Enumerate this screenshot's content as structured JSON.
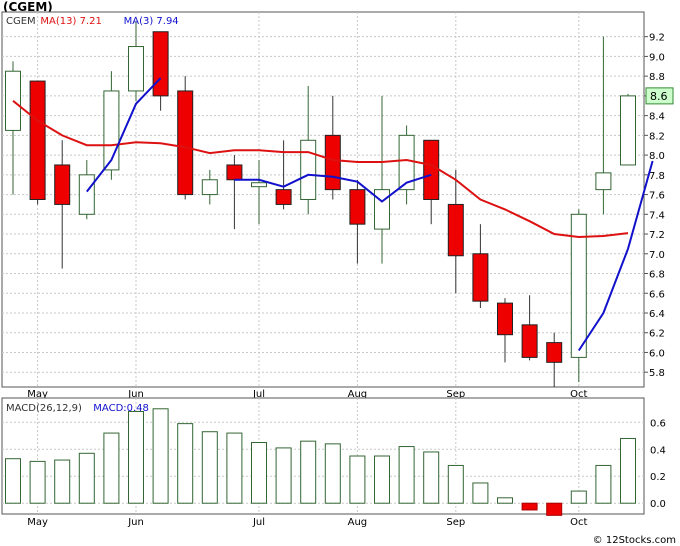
{
  "title": "(CGEM)",
  "credit": "© 12Stocks.com",
  "chart_data": [
    {
      "type": "candlestick",
      "legend": [
        {
          "label": "CGEM",
          "color": "#333333"
        },
        {
          "label": "MA(13)",
          "value": "7.21",
          "color": "#dd1111"
        },
        {
          "label": "MA(3)",
          "value": "7.94",
          "color": "#1111cc"
        }
      ],
      "last_price_label": "8.6",
      "ylim": [
        5.65,
        9.45
      ],
      "y_ticks": [
        5.8,
        6.0,
        6.2,
        6.4,
        6.6,
        6.8,
        7.0,
        7.2,
        7.4,
        7.6,
        7.8,
        8.0,
        8.2,
        8.4,
        8.6,
        8.8,
        9.0,
        9.2
      ],
      "x_ticks": [
        {
          "label": "May",
          "index": 1
        },
        {
          "label": "Jun",
          "index": 5
        },
        {
          "label": "Jul",
          "index": 10
        },
        {
          "label": "Aug",
          "index": 14
        },
        {
          "label": "Sep",
          "index": 18
        },
        {
          "label": "Oct",
          "index": 23
        }
      ],
      "candles": [
        {
          "open": 8.25,
          "high": 8.95,
          "low": 7.6,
          "close": 8.85
        },
        {
          "open": 8.75,
          "high": 8.75,
          "low": 7.5,
          "close": 7.55
        },
        {
          "open": 7.9,
          "high": 8.15,
          "low": 6.85,
          "close": 7.5
        },
        {
          "open": 7.4,
          "high": 7.95,
          "low": 7.35,
          "close": 7.8
        },
        {
          "open": 7.85,
          "high": 8.85,
          "low": 7.75,
          "close": 8.65
        },
        {
          "open": 8.65,
          "high": 9.35,
          "low": 8.55,
          "close": 9.1
        },
        {
          "open": 9.25,
          "high": 9.25,
          "low": 8.45,
          "close": 8.6
        },
        {
          "open": 8.65,
          "high": 8.8,
          "low": 7.55,
          "close": 7.6
        },
        {
          "open": 7.6,
          "high": 7.85,
          "low": 7.5,
          "close": 7.75
        },
        {
          "open": 7.9,
          "high": 8.0,
          "low": 7.25,
          "close": 7.75
        },
        {
          "open": 7.68,
          "high": 7.95,
          "low": 7.3,
          "close": 7.72
        },
        {
          "open": 7.65,
          "high": 8.15,
          "low": 7.45,
          "close": 7.5
        },
        {
          "open": 7.55,
          "high": 8.7,
          "low": 7.4,
          "close": 8.15
        },
        {
          "open": 8.2,
          "high": 8.6,
          "low": 7.55,
          "close": 7.65
        },
        {
          "open": 7.65,
          "high": 7.75,
          "low": 6.9,
          "close": 7.3
        },
        {
          "open": 7.25,
          "high": 8.6,
          "low": 6.9,
          "close": 7.65
        },
        {
          "open": 7.65,
          "high": 8.3,
          "low": 7.5,
          "close": 8.2
        },
        {
          "open": 8.15,
          "high": 8.15,
          "low": 7.3,
          "close": 7.55
        },
        {
          "open": 7.5,
          "high": 7.85,
          "low": 6.6,
          "close": 6.98
        },
        {
          "open": 7.0,
          "high": 7.3,
          "low": 6.45,
          "close": 6.52
        },
        {
          "open": 6.5,
          "high": 6.55,
          "low": 5.9,
          "close": 6.18
        },
        {
          "open": 6.28,
          "high": 6.58,
          "low": 5.92,
          "close": 5.95
        },
        {
          "open": 6.1,
          "high": 6.2,
          "low": 5.65,
          "close": 5.9
        },
        {
          "open": 5.95,
          "high": 7.45,
          "low": 5.7,
          "close": 7.4
        },
        {
          "open": 7.65,
          "high": 9.2,
          "low": 7.4,
          "close": 7.82
        },
        {
          "open": 7.9,
          "high": 8.62,
          "low": 7.9,
          "close": 8.6
        }
      ],
      "ma13": [
        8.55,
        8.35,
        8.2,
        8.1,
        8.1,
        8.13,
        8.12,
        8.08,
        8.02,
        8.05,
        8.05,
        8.03,
        8.03,
        7.95,
        7.93,
        7.93,
        7.95,
        7.9,
        7.75,
        7.55,
        7.45,
        7.33,
        7.2,
        7.17,
        7.18,
        7.21
      ],
      "ma3_from_index": 3,
      "ma3": [
        7.63,
        7.95,
        8.52,
        8.78,
        null,
        null,
        7.75,
        7.75,
        7.68,
        7.8,
        7.78,
        7.73,
        7.53,
        7.72,
        7.8,
        null,
        null,
        null,
        null,
        null,
        6.02,
        6.4,
        7.05,
        7.94
      ]
    },
    {
      "type": "bar",
      "legend": [
        {
          "label": "MACD(26,12,9)",
          "color": "#333333"
        },
        {
          "label": "MACD:0.48",
          "color": "#1111cc"
        }
      ],
      "ylim": [
        -0.08,
        0.78
      ],
      "y_ticks": [
        0.0,
        0.2,
        0.4,
        0.6
      ],
      "x_ticks": [
        {
          "label": "May",
          "index": 1
        },
        {
          "label": "Jun",
          "index": 5
        },
        {
          "label": "Jul",
          "index": 10
        },
        {
          "label": "Aug",
          "index": 14
        },
        {
          "label": "Sep",
          "index": 18
        },
        {
          "label": "Oct",
          "index": 23
        }
      ],
      "values": [
        0.33,
        0.31,
        0.32,
        0.37,
        0.52,
        0.68,
        0.7,
        0.59,
        0.53,
        0.52,
        0.45,
        0.41,
        0.46,
        0.44,
        0.35,
        0.35,
        0.42,
        0.38,
        0.28,
        0.15,
        0.04,
        -0.05,
        -0.09,
        0.09,
        0.28,
        0.48
      ]
    }
  ]
}
